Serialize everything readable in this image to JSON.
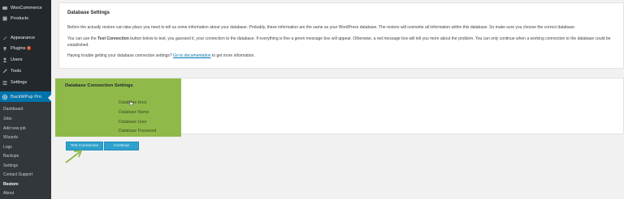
{
  "sidebar": {
    "items": [
      {
        "label": "WooCommerce",
        "icon": "woocommerce-icon"
      },
      {
        "label": "Products",
        "icon": "products-icon"
      },
      {
        "label": "Appearance",
        "icon": "appearance-icon"
      },
      {
        "label": "Plugins",
        "icon": "plugins-icon",
        "badge": "1"
      },
      {
        "label": "Users",
        "icon": "users-icon"
      },
      {
        "label": "Tools",
        "icon": "tools-icon"
      },
      {
        "label": "Settings",
        "icon": "settings-icon"
      },
      {
        "label": "BackWPup Pro",
        "icon": "backwpup-icon",
        "active": true
      }
    ],
    "submenu": [
      "Dashboard",
      "Jobs",
      "Add new job",
      "Wizards",
      "Logs",
      "Backups",
      "Settings",
      "Contact Support",
      "Restore",
      "About"
    ],
    "current_submenu": "Restore"
  },
  "database_settings": {
    "title": "Database Settings",
    "intro": "Before the actually restore can take place you need to tell us some information about your database. Probably, these information are the same as your WordPress database. The restore will overwrite all information within this database. So make sure you choose the correct database.",
    "test_info_prefix": "You can use the ",
    "test_info_bold": "Test Connection",
    "test_info_suffix": " button below to test, you guessed it, your connection to the database. If everything is fine a green message box will appear. Otherwise, a red message box will tell you more about the problem. You can only continue when a working connection to the database could be established.",
    "help_prefix": "Having trouble getting your database connection settings? ",
    "help_link": "Go to documentation",
    "help_suffix": " to get more information."
  },
  "connection_settings": {
    "title": "Database Connection Settings",
    "fields": [
      "Database Host",
      "Database Name",
      "Database User",
      "Database Password"
    ]
  },
  "buttons": {
    "test_connection": "Test Connection",
    "continue": "Continue"
  },
  "colors": {
    "sidebar_bg": "#23282d",
    "accent": "#0073aa",
    "highlight": "#8fba4a",
    "button": "#2ea2cc"
  }
}
